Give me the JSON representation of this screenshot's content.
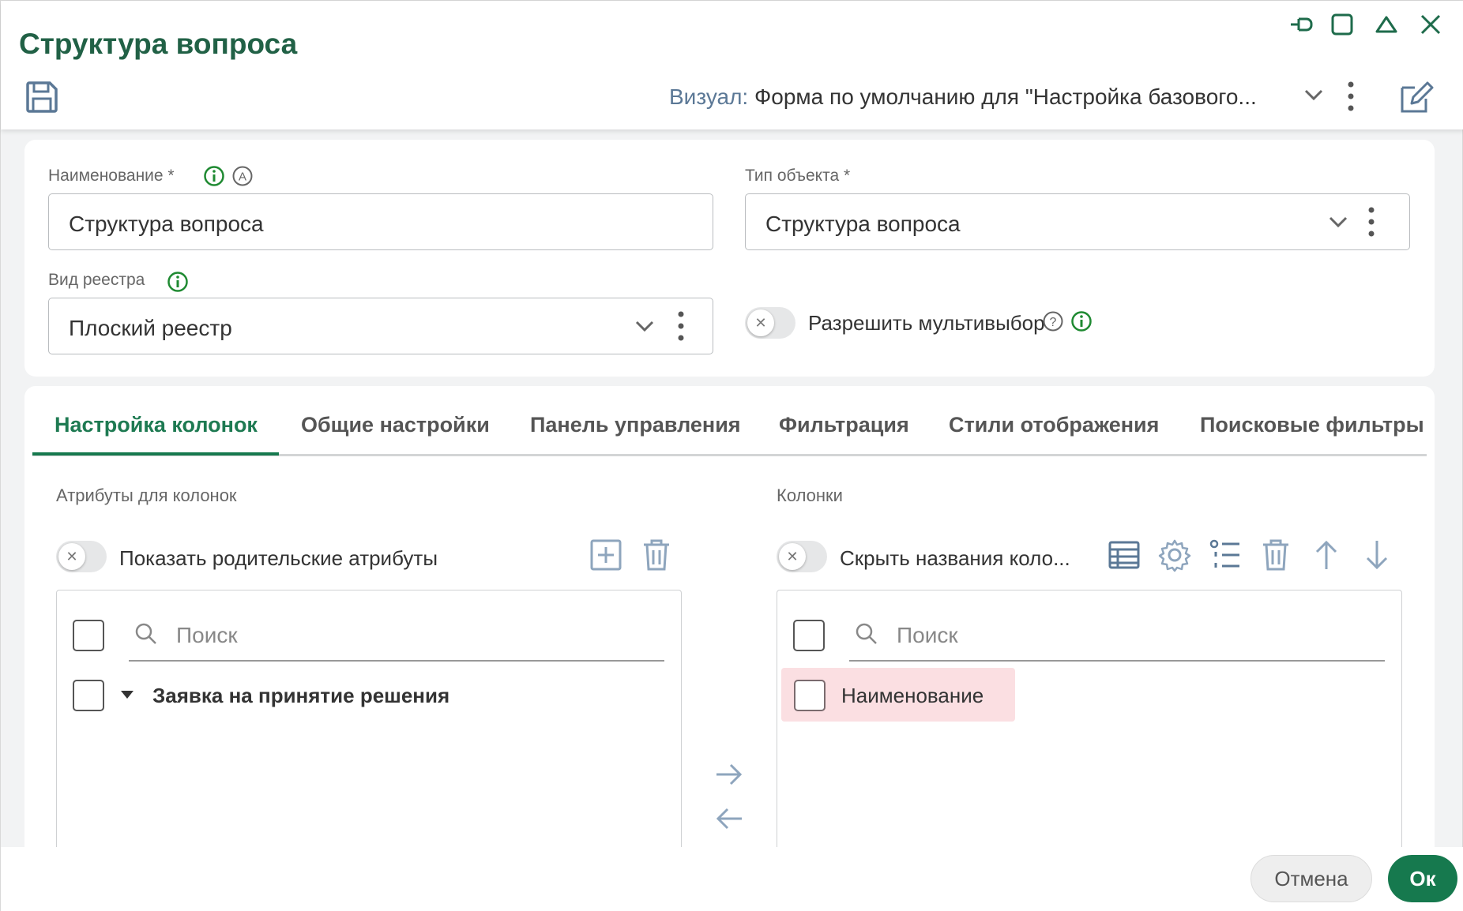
{
  "window": {
    "title": "Структура вопроса"
  },
  "header": {
    "visual_label": "Визуал:",
    "visual_value": "Форма по умолчанию для \"Настройка базового..."
  },
  "form": {
    "name_label": "Наименование *",
    "name_value": "Структура вопроса",
    "object_type_label": "Тип объекта *",
    "object_type_value": "Структура вопроса",
    "registry_type_label": "Вид реестра",
    "registry_type_value": "Плоский реестр",
    "multiselect_label": "Разрешить мультивыбор",
    "multiselect_enabled": false
  },
  "tabs": [
    {
      "label": "Настройка колонок",
      "active": true
    },
    {
      "label": "Общие настройки",
      "active": false
    },
    {
      "label": "Панель управления",
      "active": false
    },
    {
      "label": "Фильтрация",
      "active": false
    },
    {
      "label": "Стили отображения",
      "active": false
    },
    {
      "label": "Поисковые фильтры",
      "active": false
    }
  ],
  "left_panel": {
    "title": "Атрибуты для колонок",
    "toggle_label": "Показать родительские атрибуты",
    "toggle_enabled": false,
    "search_placeholder": "Поиск",
    "items": [
      {
        "label": "Заявка на принятие решения",
        "expanded": true
      }
    ]
  },
  "right_panel": {
    "title": "Колонки",
    "toggle_label": "Скрыть названия коло...",
    "toggle_enabled": false,
    "search_placeholder": "Поиск",
    "items": [
      {
        "label": "Наименование",
        "highlighted": true
      }
    ]
  },
  "buttons": {
    "cancel": "Отмена",
    "ok": "Ок"
  },
  "colors": {
    "primary": "#16794e",
    "title": "#216146",
    "highlight": "#fbdfe2",
    "icon": "#5b7896",
    "info": "#1f8a32"
  }
}
